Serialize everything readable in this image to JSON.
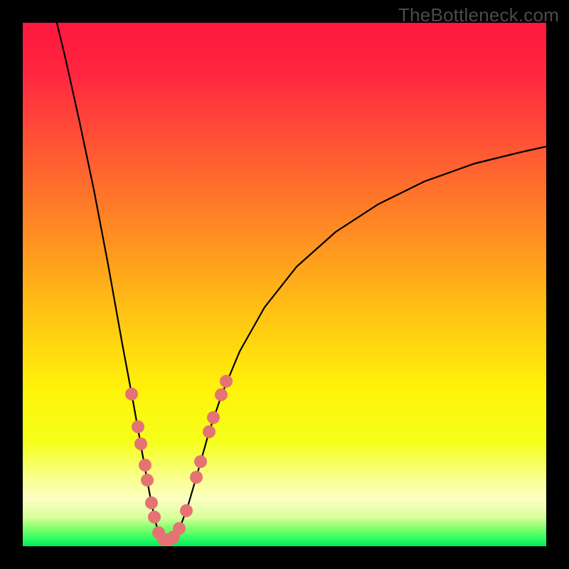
{
  "watermark": {
    "text": "TheBottleneck.com"
  },
  "colors": {
    "frame": "#000000",
    "gradient_stops": [
      {
        "pos": 0.0,
        "color": "#ff173f"
      },
      {
        "pos": 0.1,
        "color": "#ff2840"
      },
      {
        "pos": 0.25,
        "color": "#ff5a33"
      },
      {
        "pos": 0.4,
        "color": "#ff8c22"
      },
      {
        "pos": 0.55,
        "color": "#ffc114"
      },
      {
        "pos": 0.7,
        "color": "#fff30a"
      },
      {
        "pos": 0.8,
        "color": "#f5ff1a"
      },
      {
        "pos": 0.87,
        "color": "#f9ff8e"
      },
      {
        "pos": 0.91,
        "color": "#fcffc2"
      },
      {
        "pos": 0.945,
        "color": "#d8ff9a"
      },
      {
        "pos": 0.965,
        "color": "#86ff6e"
      },
      {
        "pos": 0.985,
        "color": "#2fff63"
      },
      {
        "pos": 1.0,
        "color": "#00e95b"
      }
    ],
    "curve": "#000000",
    "marker_fill": "#e57373",
    "marker_stroke": "#c25555"
  },
  "chart_data": {
    "type": "line",
    "title": "",
    "xlabel": "",
    "ylabel": "",
    "x_range": [
      0,
      736
    ],
    "y_range_note": "y is pixel from top of plot; 0 = worst (red), ~728 = best (green)",
    "series": [
      {
        "name": "bottleneck-curve",
        "note": "Approximate V-shaped bottleneck curve touching bottom near x≈200; right arm asymptotes near y≈175",
        "points": [
          {
            "x": 45,
            "y": -12
          },
          {
            "x": 60,
            "y": 50
          },
          {
            "x": 80,
            "y": 140
          },
          {
            "x": 100,
            "y": 235
          },
          {
            "x": 120,
            "y": 340
          },
          {
            "x": 140,
            "y": 452
          },
          {
            "x": 155,
            "y": 532
          },
          {
            "x": 168,
            "y": 605
          },
          {
            "x": 178,
            "y": 660
          },
          {
            "x": 186,
            "y": 700
          },
          {
            "x": 192,
            "y": 720
          },
          {
            "x": 198,
            "y": 727
          },
          {
            "x": 202,
            "y": 728
          },
          {
            "x": 208,
            "y": 727
          },
          {
            "x": 214,
            "y": 722
          },
          {
            "x": 222,
            "y": 707
          },
          {
            "x": 232,
            "y": 680
          },
          {
            "x": 246,
            "y": 632
          },
          {
            "x": 262,
            "y": 575
          },
          {
            "x": 280,
            "y": 522
          },
          {
            "x": 305,
            "y": 462
          },
          {
            "x": 340,
            "y": 400
          },
          {
            "x": 385,
            "y": 343
          },
          {
            "x": 440,
            "y": 294
          },
          {
            "x": 500,
            "y": 255
          },
          {
            "x": 565,
            "y": 223
          },
          {
            "x": 635,
            "y": 198
          },
          {
            "x": 700,
            "y": 182
          },
          {
            "x": 736,
            "y": 174
          }
        ]
      }
    ],
    "markers": {
      "name": "highlighted-samples",
      "radius": 9,
      "points": [
        {
          "x": 153,
          "y": 522
        },
        {
          "x": 162,
          "y": 568
        },
        {
          "x": 166,
          "y": 592
        },
        {
          "x": 172,
          "y": 622
        },
        {
          "x": 175,
          "y": 643
        },
        {
          "x": 181,
          "y": 675
        },
        {
          "x": 185,
          "y": 695
        },
        {
          "x": 191,
          "y": 717
        },
        {
          "x": 198,
          "y": 726
        },
        {
          "x": 205,
          "y": 727
        },
        {
          "x": 212,
          "y": 723
        },
        {
          "x": 220,
          "y": 711
        },
        {
          "x": 230,
          "y": 686
        },
        {
          "x": 244,
          "y": 639
        },
        {
          "x": 250,
          "y": 617
        },
        {
          "x": 262,
          "y": 575
        },
        {
          "x": 268,
          "y": 555
        },
        {
          "x": 279,
          "y": 523
        },
        {
          "x": 286,
          "y": 504
        }
      ]
    }
  }
}
